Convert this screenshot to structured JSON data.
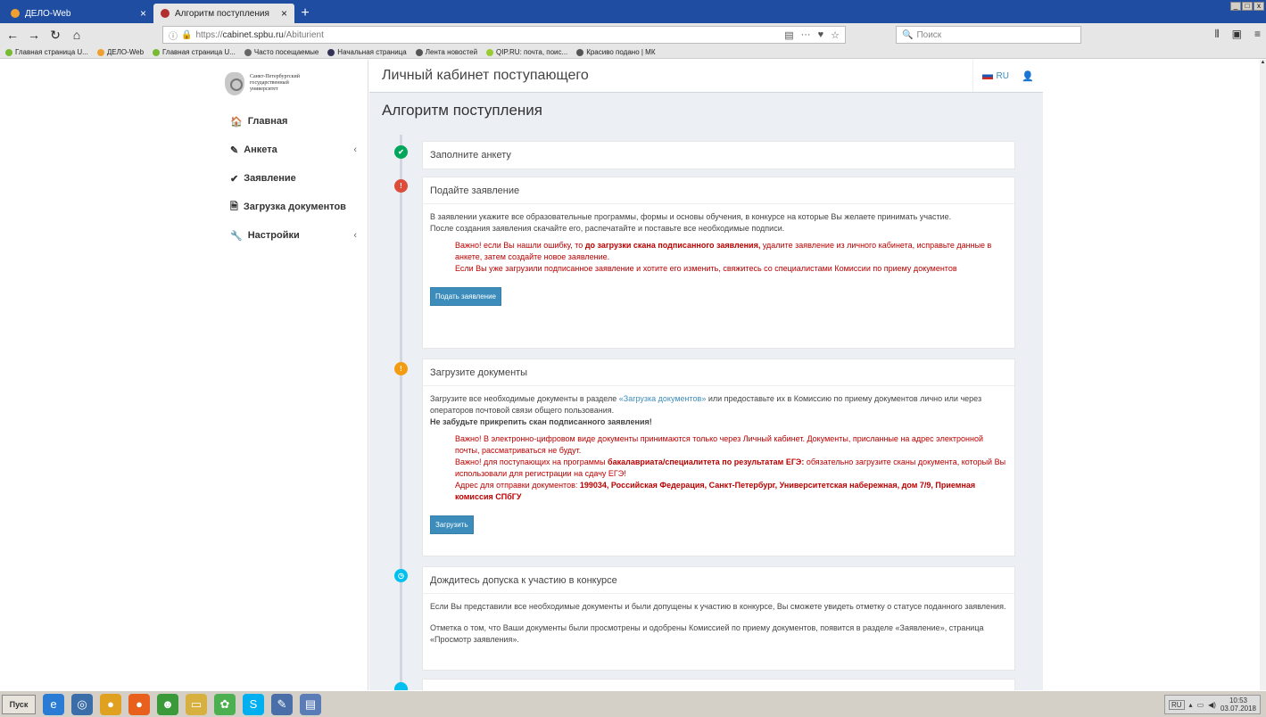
{
  "browser": {
    "tabs": [
      {
        "label": "ДЕЛО-Web",
        "active": false
      },
      {
        "label": "Алгоритм поступления",
        "active": true
      }
    ],
    "new_tab": "+",
    "close": "×",
    "url_prefix": "https://",
    "url_domain": "cabinet.spbu.ru",
    "url_path": "/Abiturient",
    "search_placeholder": "Поиск",
    "bookmarks": [
      "Главная страница U...",
      "ДЕЛО-Web",
      "Главная страница U...",
      "Часто посещаемые",
      "Начальная страница",
      "Лента новостей",
      "QIP.RU: почта, поис...",
      "Красиво подано | МК"
    ]
  },
  "site": {
    "brand": [
      "Санкт-Петербургский",
      "государственный",
      "университет"
    ],
    "header_title": "Личный кабинет поступающего",
    "lang": "RU",
    "menu": [
      {
        "icon": "home-icon",
        "glyph": "🏠",
        "label": "Главная",
        "arrow": ""
      },
      {
        "icon": "edit-icon",
        "glyph": "✎",
        "label": "Анкета",
        "arrow": "‹"
      },
      {
        "icon": "check-icon",
        "glyph": "✔",
        "label": "Заявление",
        "arrow": ""
      },
      {
        "icon": "file-icon",
        "glyph": "🗎",
        "label": "Загрузка документов",
        "arrow": ""
      },
      {
        "icon": "wrench-icon",
        "glyph": "🔧",
        "label": "Настройки",
        "arrow": "‹"
      }
    ],
    "page_title": "Алгоритм поступления",
    "steps": {
      "s1": {
        "title": "Заполните анкету",
        "icon": "✔",
        "color": "#00a65a"
      },
      "s2": {
        "title": "Подайте заявление",
        "icon": "!",
        "color": "#dd4b39",
        "p1": "В заявлении укажите все образовательные программы, формы и основы обучения, в конкурсе на которые Вы желаете принимать участие.",
        "p2": "После создания заявления скачайте его, распечатайте и поставьте все необходимые подписи.",
        "w1a": "Важно! если Вы нашли ошибку, то ",
        "w1b": "до загрузки скана подписанного заявления,",
        "w1c": " удалите заявление из личного кабинета, исправьте данные в анкете, затем создайте новое заявление.",
        "w2": "Если Вы уже загрузили подписанное заявление и хотите его изменить, свяжитесь со специалистами Комиссии по приему документов",
        "button": "Подать заявление"
      },
      "s3": {
        "title": "Загрузите документы",
        "icon": "!",
        "color": "#f39c12",
        "p1a": "Загрузите все необходимые документы в разделе ",
        "p1link": "«Загрузка документов»",
        "p1b": " или предоставьте их в Комиссию по приему документов лично или через операторов почтовой связи общего пользования.",
        "p2": "Не забудьте прикрепить скан подписанного заявления!",
        "w1": "Важно! В электронно-цифровом виде документы принимаются только через Личный кабинет. Документы, присланные на адрес электронной почты, рассматриваться не будут.",
        "w2a": "Важно! для поступающих на программы ",
        "w2b": "бакалавриата/специалитета по результатам ЕГЭ:",
        "w2c": " обязательно загрузите сканы документа, который Вы использовали для регистрации на сдачу ЕГЭ!",
        "w3a": "Адрес для отправки документов: ",
        "w3b": "199034, Российская Федерация, Санкт-Петербург, Университетская набережная, дом 7/9, Приемная комиссия СПбГУ",
        "button": "Загрузить"
      },
      "s4": {
        "title": "Дождитесь допуска к участию в конкурсе",
        "icon": "◷",
        "color": "#00c0ef",
        "p1": "Если Вы представили все необходимые документы и были допущены к участию в конкурсе, Вы сможете увидеть отметку о статусе поданного заявления.",
        "p2": "Отметка о том, что Ваши документы были просмотрены и одобрены Комиссией по приему документов, появится в разделе «Заявление», страница «Просмотр заявления»."
      }
    }
  },
  "taskbar": {
    "start": "Пуск",
    "lang": "RU",
    "time": "10:53",
    "date": "03.07.2018"
  }
}
